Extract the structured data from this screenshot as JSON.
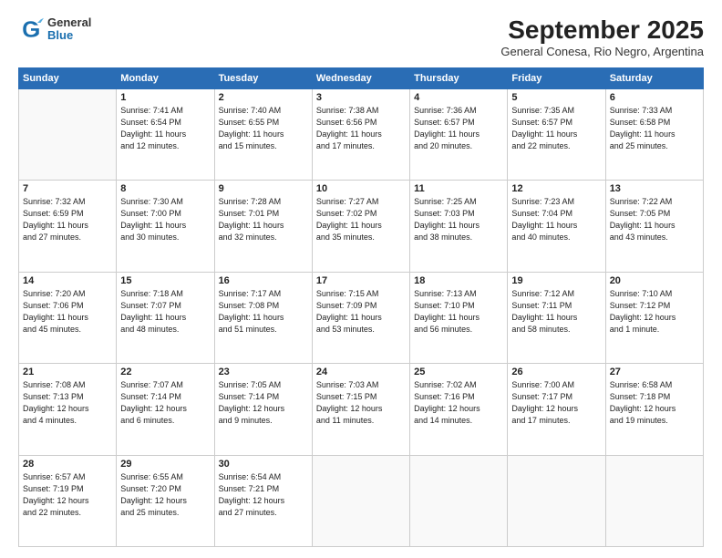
{
  "header": {
    "logo_general": "General",
    "logo_blue": "Blue",
    "title": "September 2025",
    "subtitle": "General Conesa, Rio Negro, Argentina"
  },
  "weekdays": [
    "Sunday",
    "Monday",
    "Tuesday",
    "Wednesday",
    "Thursday",
    "Friday",
    "Saturday"
  ],
  "weeks": [
    [
      {
        "day": "",
        "info": ""
      },
      {
        "day": "1",
        "info": "Sunrise: 7:41 AM\nSunset: 6:54 PM\nDaylight: 11 hours\nand 12 minutes."
      },
      {
        "day": "2",
        "info": "Sunrise: 7:40 AM\nSunset: 6:55 PM\nDaylight: 11 hours\nand 15 minutes."
      },
      {
        "day": "3",
        "info": "Sunrise: 7:38 AM\nSunset: 6:56 PM\nDaylight: 11 hours\nand 17 minutes."
      },
      {
        "day": "4",
        "info": "Sunrise: 7:36 AM\nSunset: 6:57 PM\nDaylight: 11 hours\nand 20 minutes."
      },
      {
        "day": "5",
        "info": "Sunrise: 7:35 AM\nSunset: 6:57 PM\nDaylight: 11 hours\nand 22 minutes."
      },
      {
        "day": "6",
        "info": "Sunrise: 7:33 AM\nSunset: 6:58 PM\nDaylight: 11 hours\nand 25 minutes."
      }
    ],
    [
      {
        "day": "7",
        "info": "Sunrise: 7:32 AM\nSunset: 6:59 PM\nDaylight: 11 hours\nand 27 minutes."
      },
      {
        "day": "8",
        "info": "Sunrise: 7:30 AM\nSunset: 7:00 PM\nDaylight: 11 hours\nand 30 minutes."
      },
      {
        "day": "9",
        "info": "Sunrise: 7:28 AM\nSunset: 7:01 PM\nDaylight: 11 hours\nand 32 minutes."
      },
      {
        "day": "10",
        "info": "Sunrise: 7:27 AM\nSunset: 7:02 PM\nDaylight: 11 hours\nand 35 minutes."
      },
      {
        "day": "11",
        "info": "Sunrise: 7:25 AM\nSunset: 7:03 PM\nDaylight: 11 hours\nand 38 minutes."
      },
      {
        "day": "12",
        "info": "Sunrise: 7:23 AM\nSunset: 7:04 PM\nDaylight: 11 hours\nand 40 minutes."
      },
      {
        "day": "13",
        "info": "Sunrise: 7:22 AM\nSunset: 7:05 PM\nDaylight: 11 hours\nand 43 minutes."
      }
    ],
    [
      {
        "day": "14",
        "info": "Sunrise: 7:20 AM\nSunset: 7:06 PM\nDaylight: 11 hours\nand 45 minutes."
      },
      {
        "day": "15",
        "info": "Sunrise: 7:18 AM\nSunset: 7:07 PM\nDaylight: 11 hours\nand 48 minutes."
      },
      {
        "day": "16",
        "info": "Sunrise: 7:17 AM\nSunset: 7:08 PM\nDaylight: 11 hours\nand 51 minutes."
      },
      {
        "day": "17",
        "info": "Sunrise: 7:15 AM\nSunset: 7:09 PM\nDaylight: 11 hours\nand 53 minutes."
      },
      {
        "day": "18",
        "info": "Sunrise: 7:13 AM\nSunset: 7:10 PM\nDaylight: 11 hours\nand 56 minutes."
      },
      {
        "day": "19",
        "info": "Sunrise: 7:12 AM\nSunset: 7:11 PM\nDaylight: 11 hours\nand 58 minutes."
      },
      {
        "day": "20",
        "info": "Sunrise: 7:10 AM\nSunset: 7:12 PM\nDaylight: 12 hours\nand 1 minute."
      }
    ],
    [
      {
        "day": "21",
        "info": "Sunrise: 7:08 AM\nSunset: 7:13 PM\nDaylight: 12 hours\nand 4 minutes."
      },
      {
        "day": "22",
        "info": "Sunrise: 7:07 AM\nSunset: 7:14 PM\nDaylight: 12 hours\nand 6 minutes."
      },
      {
        "day": "23",
        "info": "Sunrise: 7:05 AM\nSunset: 7:14 PM\nDaylight: 12 hours\nand 9 minutes."
      },
      {
        "day": "24",
        "info": "Sunrise: 7:03 AM\nSunset: 7:15 PM\nDaylight: 12 hours\nand 11 minutes."
      },
      {
        "day": "25",
        "info": "Sunrise: 7:02 AM\nSunset: 7:16 PM\nDaylight: 12 hours\nand 14 minutes."
      },
      {
        "day": "26",
        "info": "Sunrise: 7:00 AM\nSunset: 7:17 PM\nDaylight: 12 hours\nand 17 minutes."
      },
      {
        "day": "27",
        "info": "Sunrise: 6:58 AM\nSunset: 7:18 PM\nDaylight: 12 hours\nand 19 minutes."
      }
    ],
    [
      {
        "day": "28",
        "info": "Sunrise: 6:57 AM\nSunset: 7:19 PM\nDaylight: 12 hours\nand 22 minutes."
      },
      {
        "day": "29",
        "info": "Sunrise: 6:55 AM\nSunset: 7:20 PM\nDaylight: 12 hours\nand 25 minutes."
      },
      {
        "day": "30",
        "info": "Sunrise: 6:54 AM\nSunset: 7:21 PM\nDaylight: 12 hours\nand 27 minutes."
      },
      {
        "day": "",
        "info": ""
      },
      {
        "day": "",
        "info": ""
      },
      {
        "day": "",
        "info": ""
      },
      {
        "day": "",
        "info": ""
      }
    ]
  ]
}
